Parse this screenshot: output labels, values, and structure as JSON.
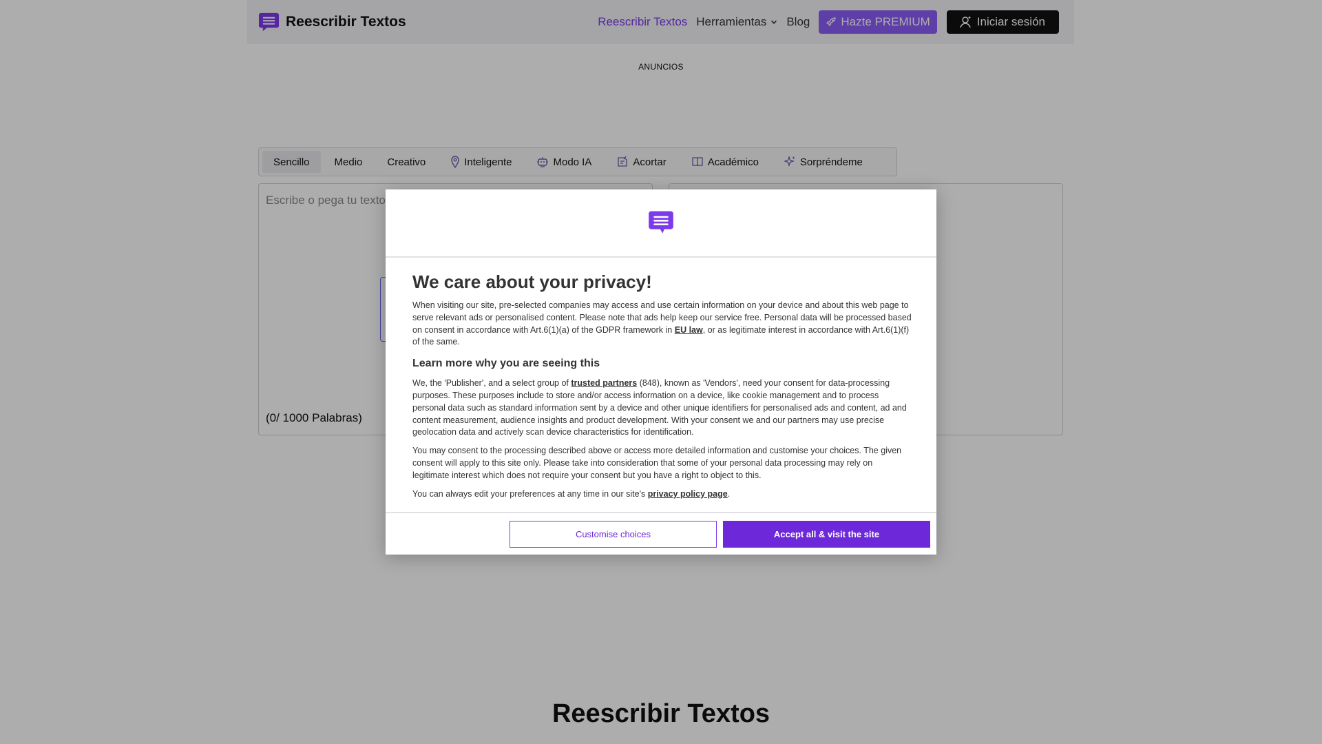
{
  "brand": {
    "name": "Reescribir Textos",
    "logo_icon": "chat-bubble-icon",
    "accent": "#7c3aed"
  },
  "nav": {
    "items": [
      "Reescribir Textos",
      "Herramientas",
      "Blog"
    ],
    "premium_label": "Hazte PREMIUM",
    "login_label": "Iniciar sesión"
  },
  "ads_label": "ANUNCIOS",
  "modes": [
    {
      "label": "Sencillo",
      "icon": ""
    },
    {
      "label": "Medio",
      "icon": ""
    },
    {
      "label": "Creativo",
      "icon": ""
    },
    {
      "label": "Inteligente",
      "icon": "pin-icon"
    },
    {
      "label": "Modo IA",
      "icon": "robot-icon"
    },
    {
      "label": "Acortar",
      "icon": "shorten-icon"
    },
    {
      "label": "Académico",
      "icon": "book-icon"
    },
    {
      "label": "Sorpréndeme",
      "icon": "sparkle-icon"
    }
  ],
  "editor": {
    "placeholder": "Escribe o pega tu texto",
    "word_count": "(0/ 1000 Palabras)"
  },
  "page_heading": "Reescribir Textos",
  "consent": {
    "title": "We care about your privacy!",
    "p1_before": "When visiting our site, pre-selected companies may access and use certain information on your device and about this web page to serve relevant ads or personalised content. Please note that ads help keep our service free. Personal data will be processed based on consent in accordance with Art.6(1)(a) of the GDPR framework in ",
    "p1_link": "EU law",
    "p1_after": ", or as legitimate interest in accordance with Art.6(1)(f) of the same.",
    "subtitle": "Learn more why you are seeing this",
    "p2_before": "We, the 'Publisher', and a select group of ",
    "p2_link": "trusted partners",
    "p2_after": " (848), known as 'Vendors', need your consent for data-processing purposes. These purposes include to store and/or access information on a device, like cookie management and to process personal data such as standard information sent by a device and other unique identifiers for personalised ads and content, ad and content measurement, audience insights and product development. With your consent we and our partners may use precise geolocation data and actively scan device characteristics for identification.",
    "p3": "You may consent to the processing described above or access more detailed information and customise your choices. The given consent will apply to this site only. Please take into consideration that some of your personal data processing may rely on legitimate interest which does not require your consent but you have a right to object to this.",
    "p4_before": "You can always edit your preferences at any time in our site's ",
    "p4_link": "privacy policy page",
    "p4_after": ".",
    "customise_label": "Customise choices",
    "accept_label": "Accept all & visit the site"
  }
}
